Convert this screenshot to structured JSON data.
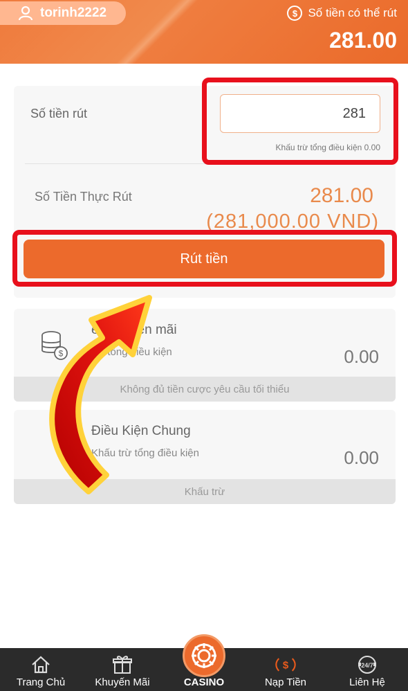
{
  "header": {
    "username": "torinh2222",
    "balance_label": "Số tiền có thể rút",
    "balance_value": "281.00"
  },
  "withdraw": {
    "amount_label": "Số tiền rút",
    "amount_value": "281",
    "deduct_note": "Khấu trừ tổng điều kiện 0.00",
    "actual_label": "Số Tiền Thực Rút",
    "actual_value": "281.00",
    "actual_vnd": "(281,000.00 VND)",
    "button_label": "Rút tiền"
  },
  "promo_card": {
    "title": "ền khuyến mãi",
    "sub": "trừ tổng điều kiện",
    "amount": "0.00",
    "footer": "Không đủ tiền cược yêu cầu tối thiểu"
  },
  "general_card": {
    "title": "Điều Kiện Chung",
    "sub": "Khấu trừ tổng điều kiện",
    "amount": "0.00",
    "footer": "Khấu trừ"
  },
  "nav": {
    "items": [
      {
        "label": "Trang Chủ",
        "icon": "home-icon"
      },
      {
        "label": "Khuyến Mãi",
        "icon": "gift-icon"
      },
      {
        "label": "CASINO",
        "icon": "casino-chip-icon"
      },
      {
        "label": "Nạp Tiền",
        "icon": "deposit-icon"
      },
      {
        "label": "Liên Hệ",
        "icon": "support-24-7-icon"
      }
    ]
  },
  "colors": {
    "brand_orange": "#ec6a2c",
    "highlight_red": "#e8101c",
    "amount_orange": "#e98a4c",
    "nav_bg": "#2b2b2b"
  }
}
